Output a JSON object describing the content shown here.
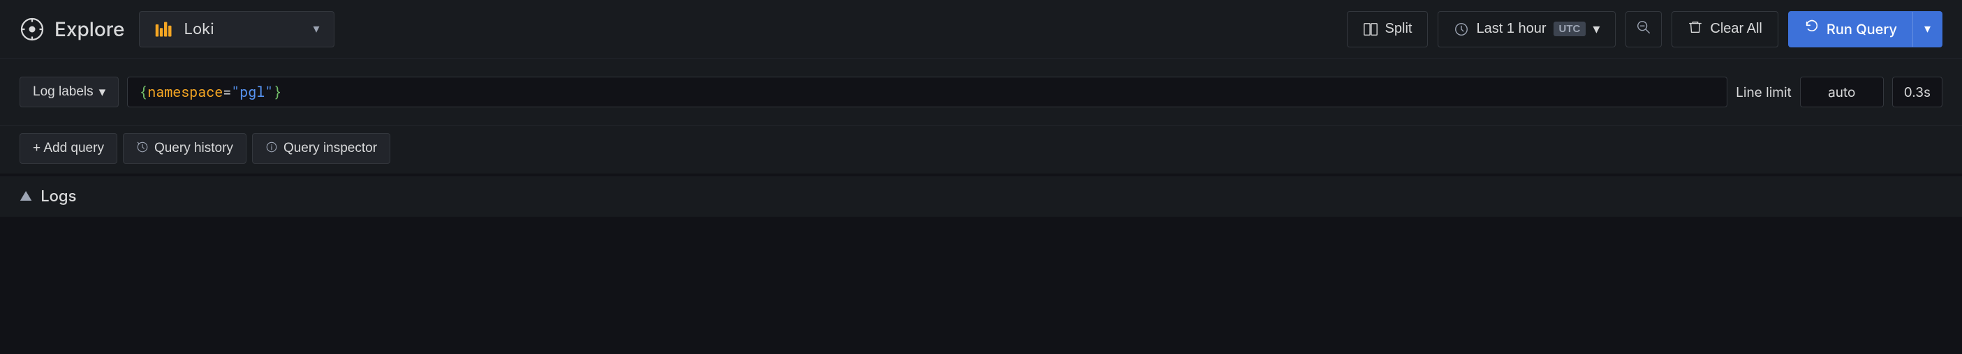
{
  "app": {
    "title": "Explore"
  },
  "datasource": {
    "name": "Loki",
    "icon": "loki-icon"
  },
  "topbar": {
    "split_label": "Split",
    "time_range": "Last 1 hour",
    "utc_label": "UTC",
    "clear_all_label": "Clear All",
    "run_query_label": "Run Query"
  },
  "query_editor": {
    "log_labels_label": "Log labels",
    "query_value": "{namespace=\"pgl\"}",
    "query_open_brace": "{",
    "query_key": "namespace",
    "query_equals": "=",
    "query_value_str": "\"pgl\"",
    "query_close_brace": "}",
    "line_limit_label": "Line limit",
    "line_limit_placeholder": "auto",
    "query_time": "0.3s"
  },
  "query_toolbar": {
    "add_query_label": "+ Add query",
    "query_history_label": "Query history",
    "query_inspector_label": "Query inspector"
  },
  "logs_section": {
    "title": "Logs"
  }
}
